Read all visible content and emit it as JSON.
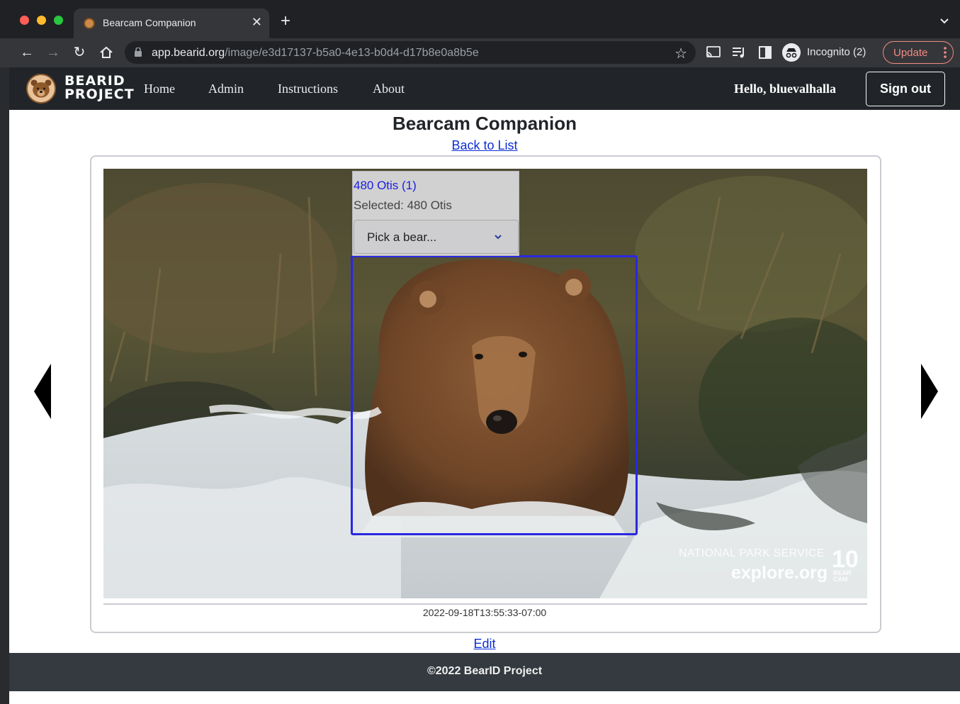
{
  "browser": {
    "tab_title": "Bearcam Companion",
    "url_host": "app.bearid.org",
    "url_path": "/image/e3d17137-b5a0-4e13-b0d4-d17b8e0a8b5e",
    "incognito_label": "Incognito (2)",
    "update_label": "Update",
    "icons": [
      "back-icon",
      "forward-icon",
      "reload-icon",
      "home-icon",
      "lock-icon",
      "star-icon",
      "cast-icon",
      "media-icon",
      "sidepanel-icon",
      "incognito-icon",
      "more-icon"
    ]
  },
  "nav": {
    "logo_line1": "BEARID",
    "logo_line2": "PROJECT",
    "links": [
      "Home",
      "Admin",
      "Instructions",
      "About"
    ],
    "greeting": "Hello, bluevalhalla",
    "signout": "Sign out"
  },
  "page": {
    "title": "Bearcam Companion",
    "back_link": "Back to List",
    "label": {
      "bear_link": "480 Otis (1)",
      "selected": "Selected: 480 Otis",
      "select_placeholder": "Pick a bear..."
    },
    "watermark": {
      "nps": "NATIONAL PARK SERVICE",
      "explore": "explore.org",
      "ten": "10",
      "cam": "BEAR CAM"
    },
    "timestamp": "2022-09-18T13:55:33-07:00",
    "edit_link": "Edit"
  },
  "footer": {
    "text": "©2022 BearID Project"
  },
  "colors": {
    "navbar": "#212529",
    "footer": "#343a40",
    "link": "#0d2dd6",
    "bbox": "#2a28e0"
  }
}
